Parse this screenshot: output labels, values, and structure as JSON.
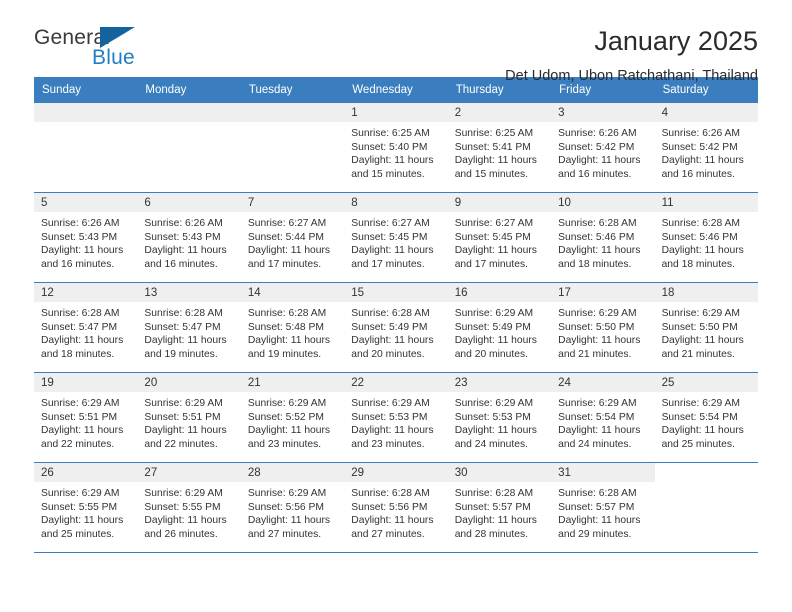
{
  "brand": {
    "word_general": "General",
    "word_blue": "Blue",
    "triangle_color": "#15639e",
    "blue_color": "#1f7fc4"
  },
  "header": {
    "title": "January 2025",
    "subtitle": "Det Udom, Ubon Ratchathani, Thailand",
    "header_bg": "#3a7ebf",
    "header_text_color": "#ffffff",
    "daynum_band_bg": "#efefef"
  },
  "weekdays": [
    "Sunday",
    "Monday",
    "Tuesday",
    "Wednesday",
    "Thursday",
    "Friday",
    "Saturday"
  ],
  "weeks": [
    [
      {
        "day": "",
        "empty": true
      },
      {
        "day": "",
        "empty": true
      },
      {
        "day": "",
        "empty": true
      },
      {
        "day": "1",
        "sunrise": "Sunrise: 6:25 AM",
        "sunset": "Sunset: 5:40 PM",
        "daylight1": "Daylight: 11 hours",
        "daylight2": "and 15 minutes."
      },
      {
        "day": "2",
        "sunrise": "Sunrise: 6:25 AM",
        "sunset": "Sunset: 5:41 PM",
        "daylight1": "Daylight: 11 hours",
        "daylight2": "and 15 minutes."
      },
      {
        "day": "3",
        "sunrise": "Sunrise: 6:26 AM",
        "sunset": "Sunset: 5:42 PM",
        "daylight1": "Daylight: 11 hours",
        "daylight2": "and 16 minutes."
      },
      {
        "day": "4",
        "sunrise": "Sunrise: 6:26 AM",
        "sunset": "Sunset: 5:42 PM",
        "daylight1": "Daylight: 11 hours",
        "daylight2": "and 16 minutes."
      }
    ],
    [
      {
        "day": "5",
        "sunrise": "Sunrise: 6:26 AM",
        "sunset": "Sunset: 5:43 PM",
        "daylight1": "Daylight: 11 hours",
        "daylight2": "and 16 minutes."
      },
      {
        "day": "6",
        "sunrise": "Sunrise: 6:26 AM",
        "sunset": "Sunset: 5:43 PM",
        "daylight1": "Daylight: 11 hours",
        "daylight2": "and 16 minutes."
      },
      {
        "day": "7",
        "sunrise": "Sunrise: 6:27 AM",
        "sunset": "Sunset: 5:44 PM",
        "daylight1": "Daylight: 11 hours",
        "daylight2": "and 17 minutes."
      },
      {
        "day": "8",
        "sunrise": "Sunrise: 6:27 AM",
        "sunset": "Sunset: 5:45 PM",
        "daylight1": "Daylight: 11 hours",
        "daylight2": "and 17 minutes."
      },
      {
        "day": "9",
        "sunrise": "Sunrise: 6:27 AM",
        "sunset": "Sunset: 5:45 PM",
        "daylight1": "Daylight: 11 hours",
        "daylight2": "and 17 minutes."
      },
      {
        "day": "10",
        "sunrise": "Sunrise: 6:28 AM",
        "sunset": "Sunset: 5:46 PM",
        "daylight1": "Daylight: 11 hours",
        "daylight2": "and 18 minutes."
      },
      {
        "day": "11",
        "sunrise": "Sunrise: 6:28 AM",
        "sunset": "Sunset: 5:46 PM",
        "daylight1": "Daylight: 11 hours",
        "daylight2": "and 18 minutes."
      }
    ],
    [
      {
        "day": "12",
        "sunrise": "Sunrise: 6:28 AM",
        "sunset": "Sunset: 5:47 PM",
        "daylight1": "Daylight: 11 hours",
        "daylight2": "and 18 minutes."
      },
      {
        "day": "13",
        "sunrise": "Sunrise: 6:28 AM",
        "sunset": "Sunset: 5:47 PM",
        "daylight1": "Daylight: 11 hours",
        "daylight2": "and 19 minutes."
      },
      {
        "day": "14",
        "sunrise": "Sunrise: 6:28 AM",
        "sunset": "Sunset: 5:48 PM",
        "daylight1": "Daylight: 11 hours",
        "daylight2": "and 19 minutes."
      },
      {
        "day": "15",
        "sunrise": "Sunrise: 6:28 AM",
        "sunset": "Sunset: 5:49 PM",
        "daylight1": "Daylight: 11 hours",
        "daylight2": "and 20 minutes."
      },
      {
        "day": "16",
        "sunrise": "Sunrise: 6:29 AM",
        "sunset": "Sunset: 5:49 PM",
        "daylight1": "Daylight: 11 hours",
        "daylight2": "and 20 minutes."
      },
      {
        "day": "17",
        "sunrise": "Sunrise: 6:29 AM",
        "sunset": "Sunset: 5:50 PM",
        "daylight1": "Daylight: 11 hours",
        "daylight2": "and 21 minutes."
      },
      {
        "day": "18",
        "sunrise": "Sunrise: 6:29 AM",
        "sunset": "Sunset: 5:50 PM",
        "daylight1": "Daylight: 11 hours",
        "daylight2": "and 21 minutes."
      }
    ],
    [
      {
        "day": "19",
        "sunrise": "Sunrise: 6:29 AM",
        "sunset": "Sunset: 5:51 PM",
        "daylight1": "Daylight: 11 hours",
        "daylight2": "and 22 minutes."
      },
      {
        "day": "20",
        "sunrise": "Sunrise: 6:29 AM",
        "sunset": "Sunset: 5:51 PM",
        "daylight1": "Daylight: 11 hours",
        "daylight2": "and 22 minutes."
      },
      {
        "day": "21",
        "sunrise": "Sunrise: 6:29 AM",
        "sunset": "Sunset: 5:52 PM",
        "daylight1": "Daylight: 11 hours",
        "daylight2": "and 23 minutes."
      },
      {
        "day": "22",
        "sunrise": "Sunrise: 6:29 AM",
        "sunset": "Sunset: 5:53 PM",
        "daylight1": "Daylight: 11 hours",
        "daylight2": "and 23 minutes."
      },
      {
        "day": "23",
        "sunrise": "Sunrise: 6:29 AM",
        "sunset": "Sunset: 5:53 PM",
        "daylight1": "Daylight: 11 hours",
        "daylight2": "and 24 minutes."
      },
      {
        "day": "24",
        "sunrise": "Sunrise: 6:29 AM",
        "sunset": "Sunset: 5:54 PM",
        "daylight1": "Daylight: 11 hours",
        "daylight2": "and 24 minutes."
      },
      {
        "day": "25",
        "sunrise": "Sunrise: 6:29 AM",
        "sunset": "Sunset: 5:54 PM",
        "daylight1": "Daylight: 11 hours",
        "daylight2": "and 25 minutes."
      }
    ],
    [
      {
        "day": "26",
        "sunrise": "Sunrise: 6:29 AM",
        "sunset": "Sunset: 5:55 PM",
        "daylight1": "Daylight: 11 hours",
        "daylight2": "and 25 minutes."
      },
      {
        "day": "27",
        "sunrise": "Sunrise: 6:29 AM",
        "sunset": "Sunset: 5:55 PM",
        "daylight1": "Daylight: 11 hours",
        "daylight2": "and 26 minutes."
      },
      {
        "day": "28",
        "sunrise": "Sunrise: 6:29 AM",
        "sunset": "Sunset: 5:56 PM",
        "daylight1": "Daylight: 11 hours",
        "daylight2": "and 27 minutes."
      },
      {
        "day": "29",
        "sunrise": "Sunrise: 6:28 AM",
        "sunset": "Sunset: 5:56 PM",
        "daylight1": "Daylight: 11 hours",
        "daylight2": "and 27 minutes."
      },
      {
        "day": "30",
        "sunrise": "Sunrise: 6:28 AM",
        "sunset": "Sunset: 5:57 PM",
        "daylight1": "Daylight: 11 hours",
        "daylight2": "and 28 minutes."
      },
      {
        "day": "31",
        "sunrise": "Sunrise: 6:28 AM",
        "sunset": "Sunset: 5:57 PM",
        "daylight1": "Daylight: 11 hours",
        "daylight2": "and 29 minutes."
      },
      {
        "day": "",
        "empty": true,
        "noband": true
      }
    ]
  ]
}
